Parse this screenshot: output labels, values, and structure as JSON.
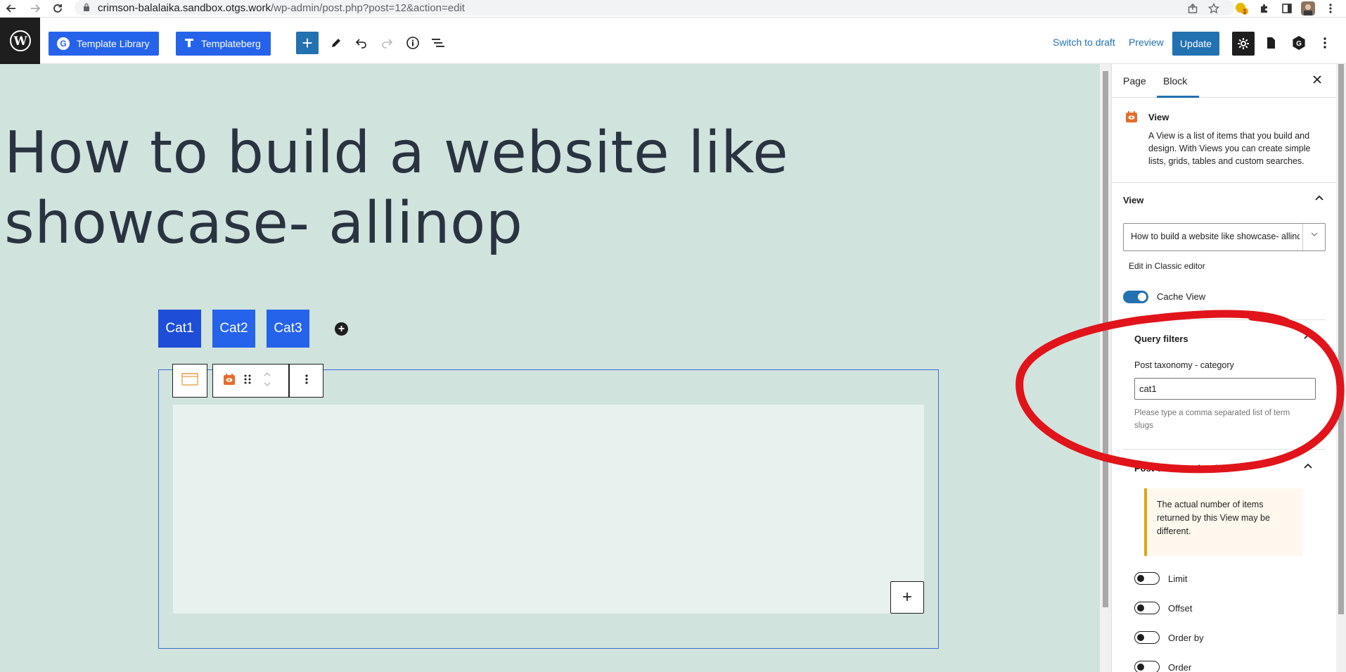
{
  "browser": {
    "url_host": "crimson-balalaika.sandbox.otgs.work",
    "url_path": "/wp-admin/post.php?post=12&action=edit",
    "extension_badge": "1"
  },
  "toolbar": {
    "template_library_label": "Template Library",
    "templateberg_label": "Templateberg",
    "switch_to_draft_label": "Switch to draft",
    "preview_label": "Preview",
    "update_label": "Update"
  },
  "canvas": {
    "title": "How to build a website like showcase- allinop",
    "categories": [
      "Cat1",
      "Cat2",
      "Cat3"
    ]
  },
  "sidebar": {
    "tabs": [
      "Page",
      "Block"
    ],
    "active_tab": "Block",
    "block_card": {
      "title": "View",
      "description": "A View is a list of items that you build and design. With Views you can create simple lists, grids, tables and custom searches."
    },
    "view_panel": {
      "title": "View",
      "selected_view": "How to build a website like showcase- allinop",
      "edit_link": "Edit in Classic editor",
      "cache_label": "Cache View",
      "cache_enabled": true
    },
    "query_filters": {
      "title": "Query filters",
      "field_label": "Post taxonomy - category",
      "field_value": "cat1",
      "help": "Please type a comma separated list of term slugs"
    },
    "post_count": {
      "title": "Post count and order",
      "notice": "The actual number of items returned by this View may be different.",
      "toggles": [
        {
          "label": "Limit",
          "enabled": false
        },
        {
          "label": "Offset",
          "enabled": false
        },
        {
          "label": "Order by",
          "enabled": false
        },
        {
          "label": "Order",
          "enabled": false
        }
      ]
    }
  },
  "colors": {
    "wp_blue": "#2271b1",
    "button_blue": "#2563eb",
    "canvas_bg": "#d1e3dd",
    "annotation_red": "#e0141a",
    "notice_border": "#dba617"
  }
}
